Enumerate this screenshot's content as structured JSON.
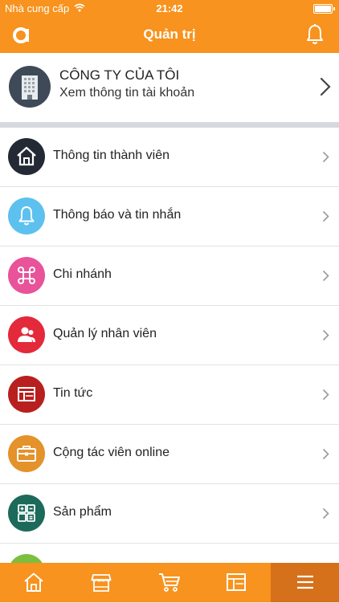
{
  "status_bar": {
    "carrier": "Nhà cung cấp",
    "time": "21:42"
  },
  "header": {
    "title": "Quản trị",
    "logo_icon": "app-logo-icon",
    "bell_icon": "bell-icon"
  },
  "company": {
    "name": "CÔNG TY CỦA TÔI",
    "subtitle": "Xem thông tin tài khoản",
    "avatar_icon": "building-icon"
  },
  "menu": {
    "items": [
      {
        "label": "Thông tin thành viên",
        "icon": "home-icon",
        "color": "#232a35"
      },
      {
        "label": "Thông báo và tin nhắn",
        "icon": "bell-icon",
        "color": "#5cc1ee"
      },
      {
        "label": "Chi nhánh",
        "icon": "command-icon",
        "color": "#e8539a"
      },
      {
        "label": "Quản lý nhân viên",
        "icon": "users-icon",
        "color": "#e3293a"
      },
      {
        "label": "Tin tức",
        "icon": "news-icon",
        "color": "#b8201f"
      },
      {
        "label": "Cộng tác viên online",
        "icon": "briefcase-icon",
        "color": "#e4922a"
      },
      {
        "label": "Sản phẩm",
        "icon": "calculator-icon",
        "color": "#1c6a5a"
      },
      {
        "label": "",
        "icon": "document-icon",
        "color": "#7cbf3f"
      }
    ]
  },
  "tab_bar": {
    "tabs": [
      {
        "icon": "home-icon",
        "active": false
      },
      {
        "icon": "store-icon",
        "active": false
      },
      {
        "icon": "cart-icon",
        "active": false
      },
      {
        "icon": "layout-icon",
        "active": false
      },
      {
        "icon": "menu-icon",
        "active": true
      }
    ]
  },
  "colors": {
    "brand": "#f7931e",
    "brand_active": "#d5701b"
  }
}
